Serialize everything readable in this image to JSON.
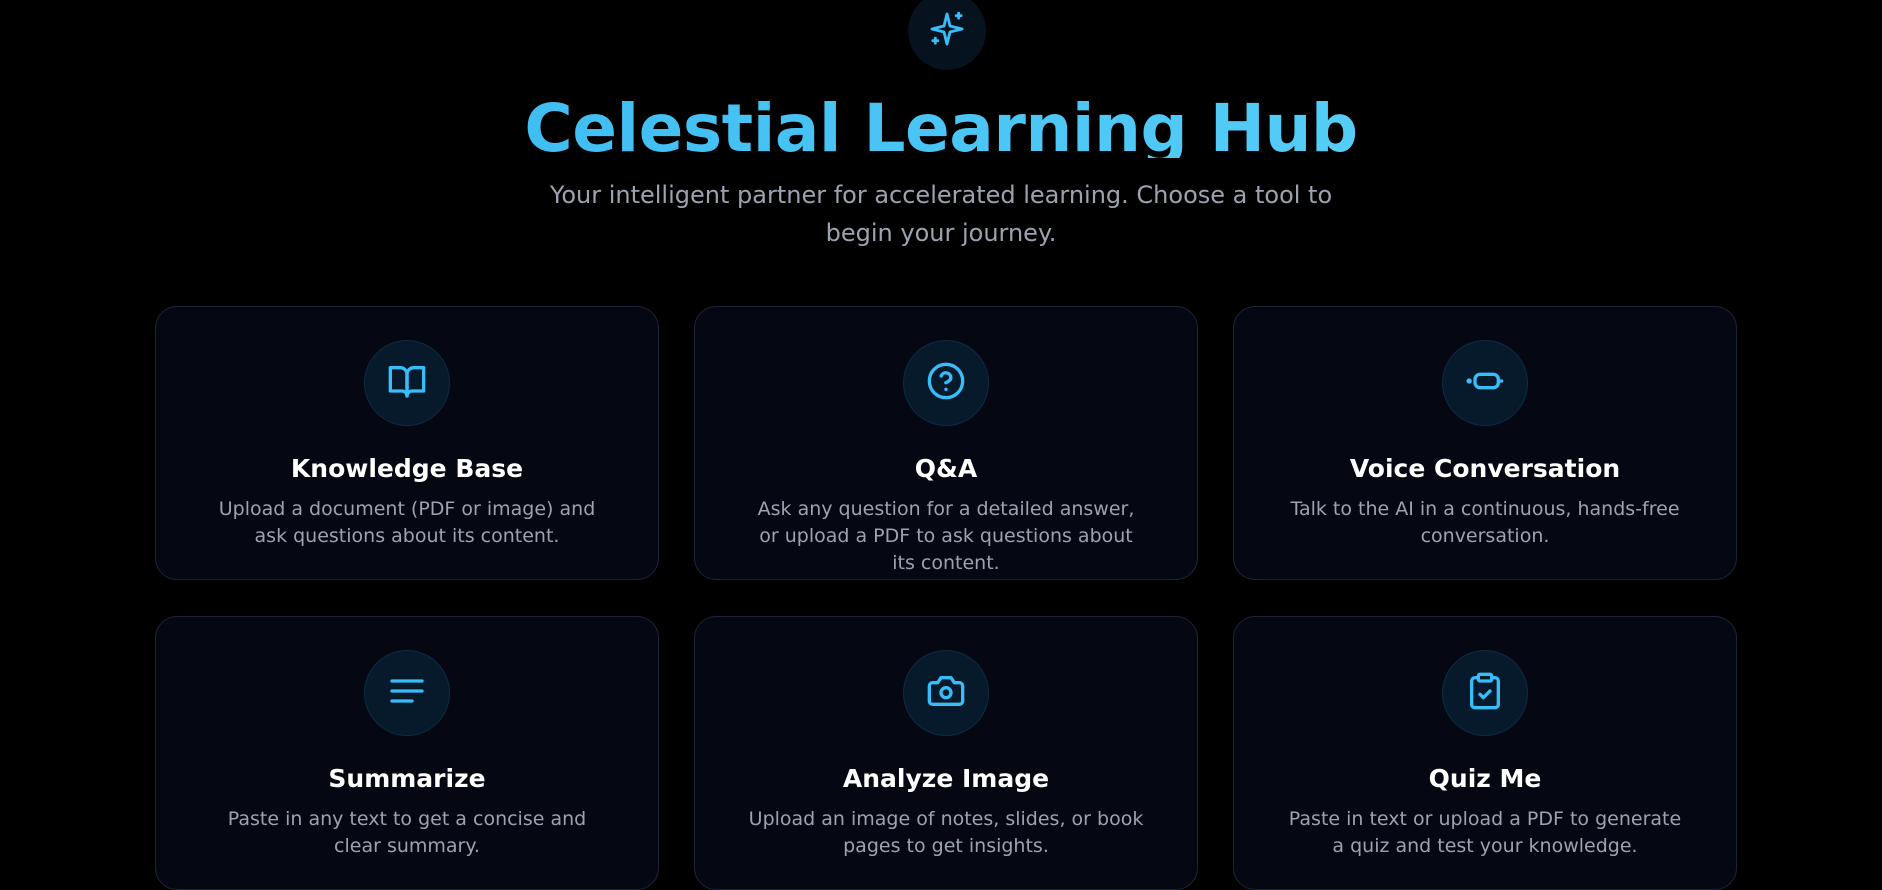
{
  "header": {
    "icon": "sparkles-icon",
    "title": "Celestial Learning Hub",
    "subtitle": "Your intelligent partner for accelerated learning. Choose a tool to begin your journey."
  },
  "colors": {
    "accent": "#38bdf8",
    "background": "#000000",
    "card_background": "#050812",
    "card_border": "#1b2537",
    "muted_text": "#9ca3af"
  },
  "tools": [
    {
      "icon": "book-open-icon",
      "title": "Knowledge Base",
      "description": "Upload a document (PDF or image) and ask questions about its content."
    },
    {
      "icon": "help-circle-icon",
      "title": "Q&A",
      "description": "Ask any question for a detailed answer, or upload a PDF to ask questions about its content."
    },
    {
      "icon": "voice-chat-icon",
      "title": "Voice Conversation",
      "description": "Talk to the AI in a continuous, hands-free conversation."
    },
    {
      "icon": "text-lines-icon",
      "title": "Summarize",
      "description": "Paste in any text to get a concise and clear summary."
    },
    {
      "icon": "camera-icon",
      "title": "Analyze Image",
      "description": "Upload an image of notes, slides, or book pages to get insights."
    },
    {
      "icon": "clipboard-check-icon",
      "title": "Quiz Me",
      "description": "Paste in text or upload a PDF to generate a quiz and test your knowledge."
    }
  ]
}
